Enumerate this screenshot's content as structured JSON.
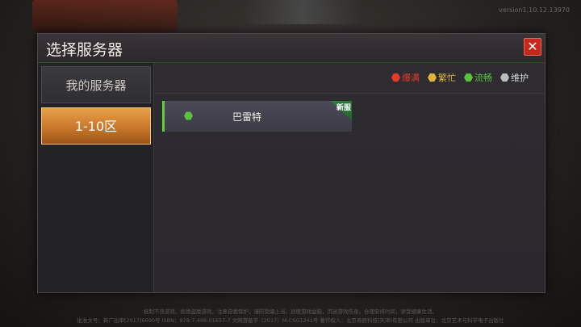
{
  "version": "version1.10.12.13970",
  "dialog": {
    "title": "选择服务器",
    "close_label": "✕"
  },
  "tabs": [
    {
      "label": "我的服务器",
      "selected": false
    },
    {
      "label": "1-10区",
      "selected": true
    }
  ],
  "legend": [
    {
      "label": "爆满",
      "color": "#e23a2c"
    },
    {
      "label": "繁忙",
      "color": "#e0b53a"
    },
    {
      "label": "流畅",
      "color": "#5cc23e"
    },
    {
      "label": "维护",
      "color": "#bdbdbd"
    }
  ],
  "servers": [
    {
      "name": "巴雷特",
      "status_color": "#5cc23e",
      "badge": "新服"
    }
  ],
  "footer": {
    "line1": "抵制不良游戏，拒绝盗版游戏。注意自我保护，谨防受骗上当。适度游戏益脑，沉迷游戏伤身。合理安排时间，享受健康生活。",
    "line2": "批准文号：新广出审[2017]6690号  ISBN：978-7-498-01657-7  文网游备字〔2017〕M-CSG1241号  著作权人：北京奇辰科技(天津)有限公司  出版单位：北京艺术与科学电子出版社"
  }
}
